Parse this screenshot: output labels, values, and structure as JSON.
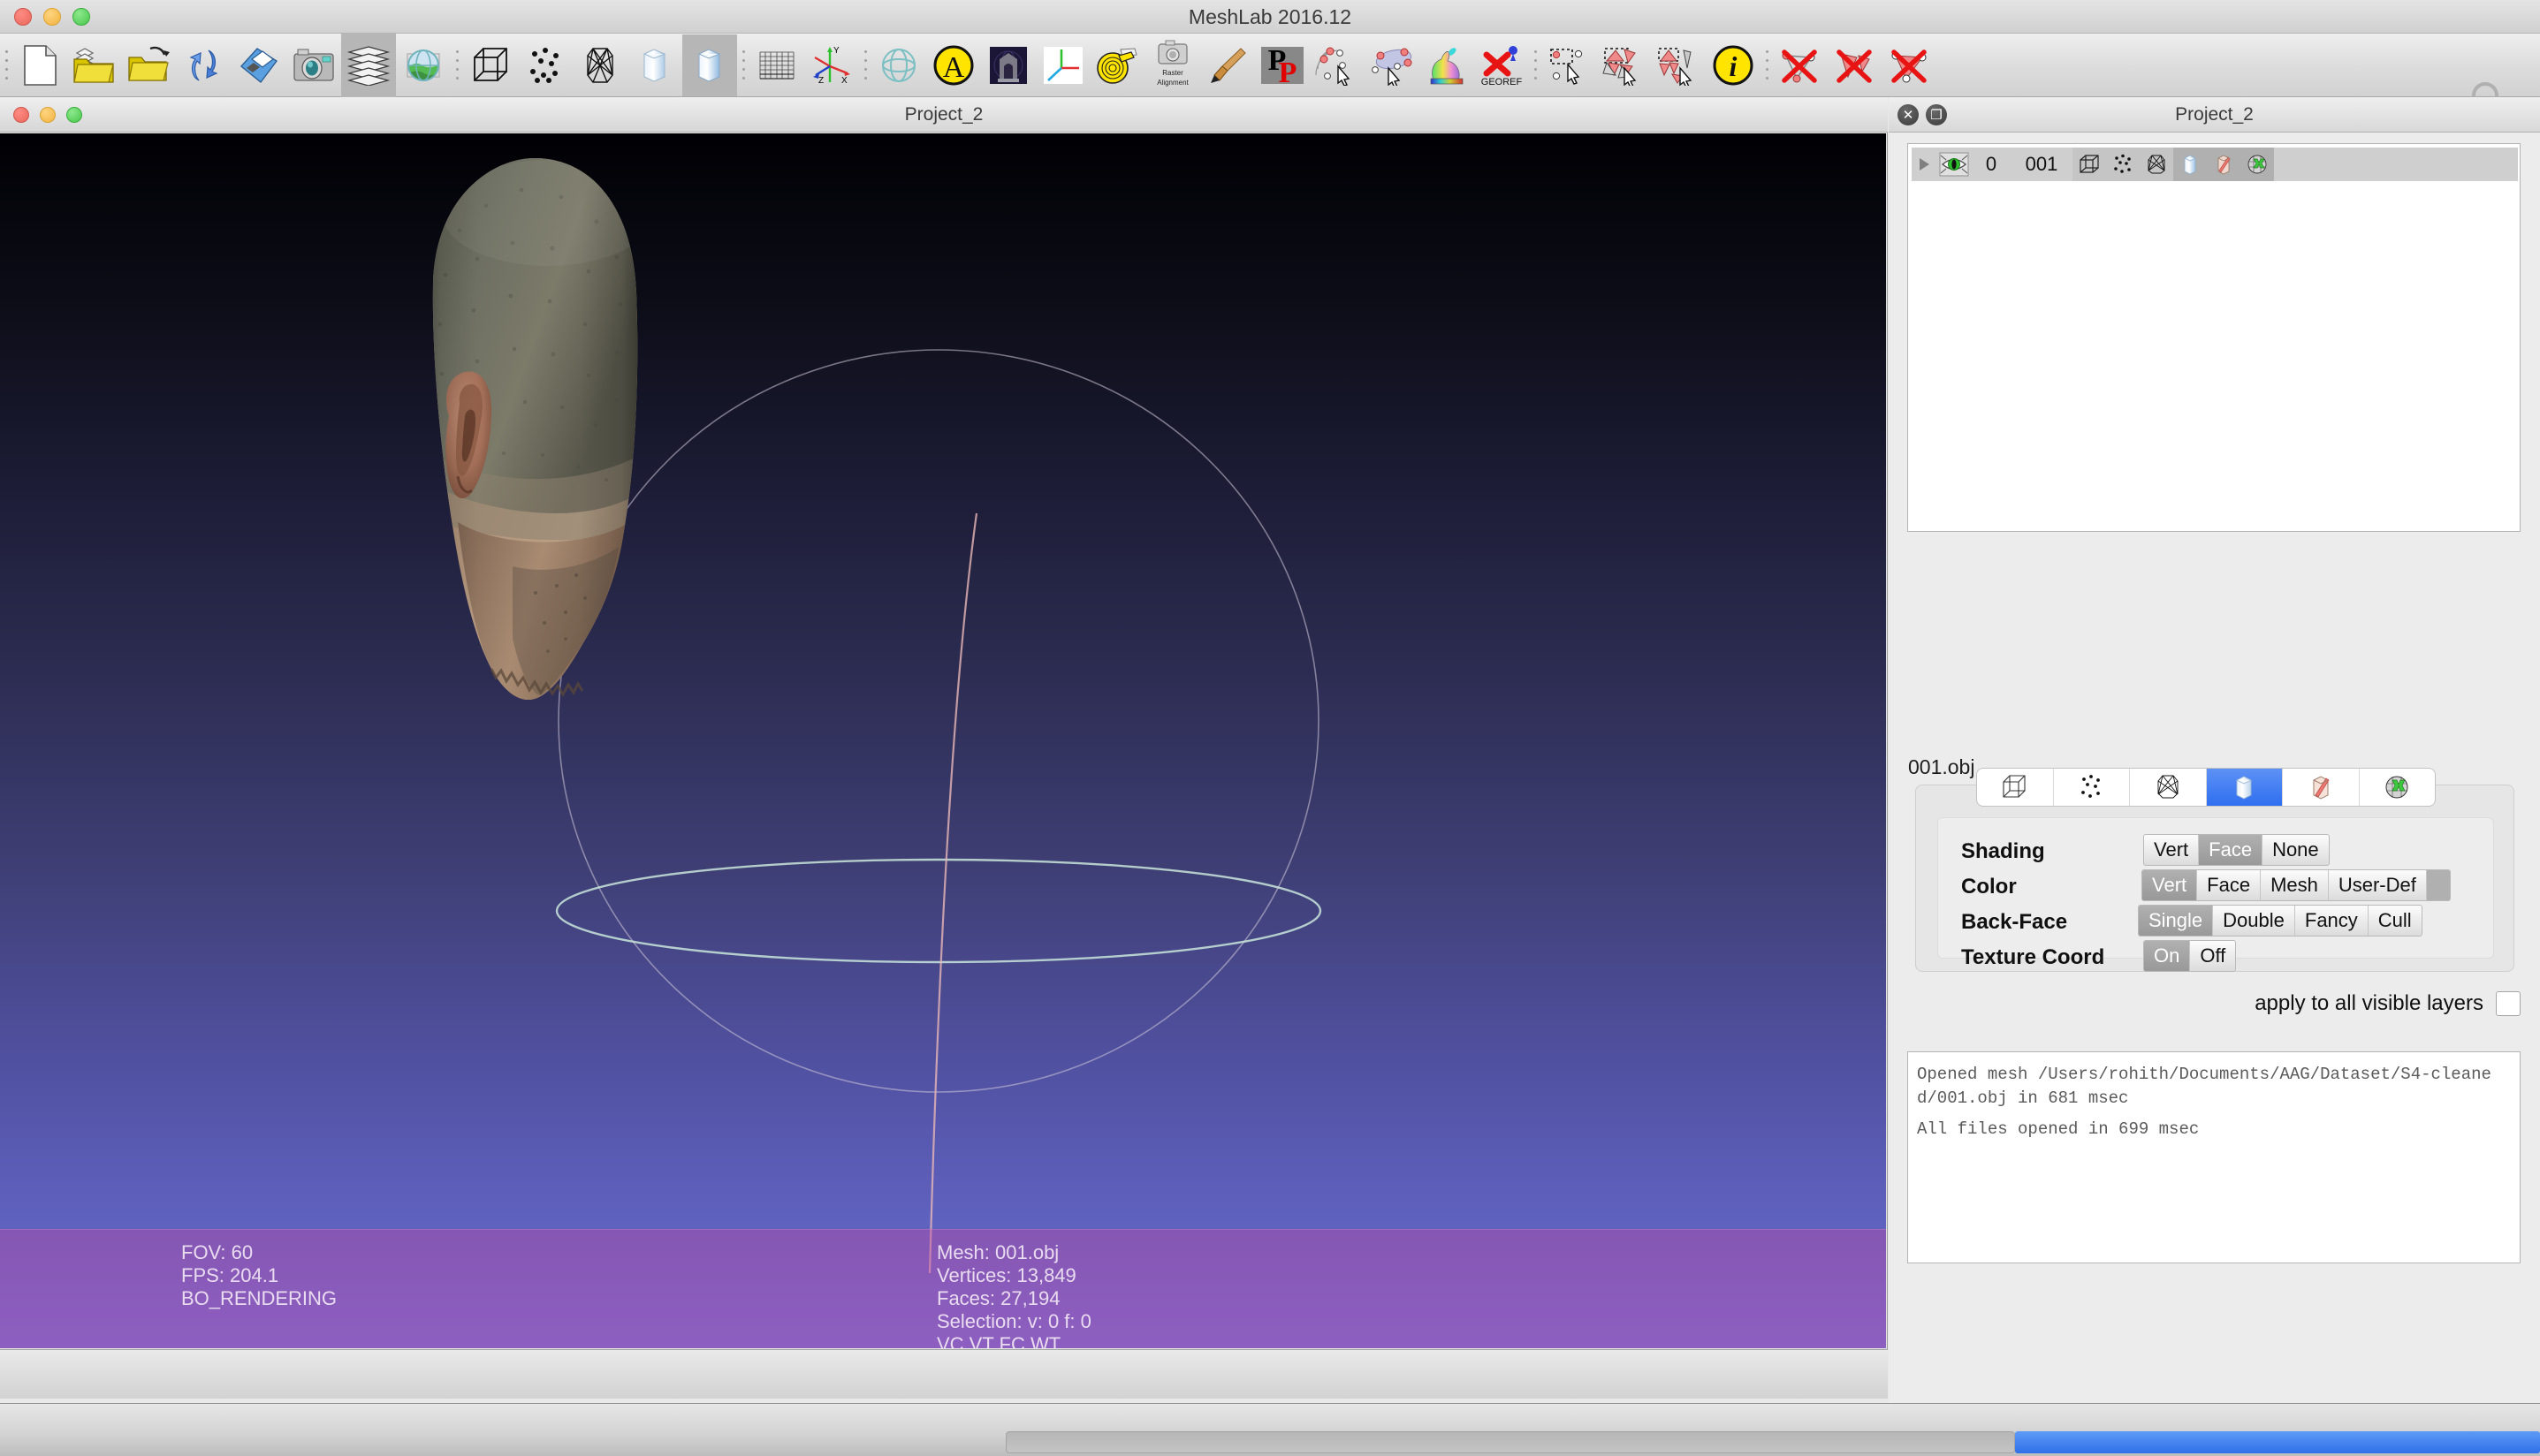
{
  "app": {
    "title": "MeshLab 2016.12",
    "window_controls": [
      "close",
      "minimize",
      "maximize"
    ]
  },
  "toolbar": {
    "groups": [
      {
        "name": "file",
        "buttons": [
          {
            "icon": "new-document-icon",
            "label": "New Project"
          },
          {
            "icon": "open-project-icon",
            "label": "Open Project"
          },
          {
            "icon": "open-mesh-icon",
            "label": "Import Mesh"
          },
          {
            "icon": "reload-icon",
            "label": "Reload"
          },
          {
            "icon": "save-mesh-icon",
            "label": "Save Mesh"
          },
          {
            "icon": "snapshot-camera-icon",
            "label": "Take Snapshot"
          }
        ]
      },
      {
        "name": "layers",
        "buttons": [
          {
            "icon": "layers-stack-icon",
            "label": "Show Layer Dialog",
            "selected": true
          }
        ]
      },
      {
        "name": "view-globe",
        "buttons": [
          {
            "icon": "globe-raster-icon",
            "label": "Show Raster"
          }
        ]
      },
      {
        "name": "render-modes",
        "buttons": [
          {
            "icon": "bounding-box-icon",
            "label": "Bounding Box"
          },
          {
            "icon": "points-icon",
            "label": "Points"
          },
          {
            "icon": "wireframe-icon",
            "label": "Wireframe"
          },
          {
            "icon": "flat-lines-icon",
            "label": "Flat Lines"
          },
          {
            "icon": "smooth-shading-icon",
            "label": "Smooth",
            "selected": true
          }
        ]
      },
      {
        "name": "helpers",
        "buttons": [
          {
            "icon": "grid-plane-icon",
            "label": "Show Grid"
          },
          {
            "icon": "axis-xyz-icon",
            "label": "Show Axis"
          }
        ]
      },
      {
        "name": "decorations",
        "buttons": [
          {
            "icon": "trackball-sphere-icon",
            "label": "Show Trackball"
          },
          {
            "icon": "yellow-a-icon",
            "label": "Show Text"
          },
          {
            "icon": "arch-render-icon",
            "label": "Shadow Render"
          },
          {
            "icon": "axis-cross-icon",
            "label": "Show Quoted Box"
          },
          {
            "icon": "measure-tape-icon",
            "label": "Measuring Tool"
          },
          {
            "icon": "raster-alignment-icon",
            "label": "Raster Alignment"
          },
          {
            "icon": "paintbrush-icon",
            "label": "Z-Painting"
          },
          {
            "icon": "pp-picker-icon",
            "label": "PickPoints"
          }
        ]
      },
      {
        "name": "alignment",
        "buttons": [
          {
            "icon": "point-select-icon",
            "label": "Select Points"
          },
          {
            "icon": "align-mesh-icon",
            "label": "Align Mesh"
          },
          {
            "icon": "colorize-bunny-icon",
            "label": "Quality Mapper"
          },
          {
            "icon": "georef-icon",
            "label": "GEOREF"
          }
        ]
      },
      {
        "name": "selection",
        "buttons": [
          {
            "icon": "select-vertices-rect-icon",
            "label": "Select Vertices"
          },
          {
            "icon": "select-faces-rect-icon",
            "label": "Select Faces"
          },
          {
            "icon": "select-connected-icon",
            "label": "Select Connected Component"
          },
          {
            "icon": "info-icon",
            "label": "Get Info"
          }
        ]
      },
      {
        "name": "delete",
        "buttons": [
          {
            "icon": "delete-vertices-icon",
            "label": "Delete Selected Vertices"
          },
          {
            "icon": "delete-faces-icon",
            "label": "Delete Selected Faces"
          },
          {
            "icon": "delete-faces-vertices-icon",
            "label": "Delete Selected Faces and Vertices"
          }
        ]
      }
    ],
    "search_icon": "search-icon"
  },
  "document_window": {
    "title": "Project_2",
    "viewport": {
      "background_top_color": "#000004",
      "background_bottom_color": "#6d70d6",
      "trackball_visible": true,
      "mesh_description": "3D scanned human head viewed from behind"
    },
    "overlay": {
      "fov": "FOV: 60",
      "fps": "FPS:   204.1",
      "rendering_mode": "BO_RENDERING",
      "mesh": "Mesh: 001.obj",
      "vertices": "Vertices: 13,849",
      "faces": "Faces: 27,194",
      "selection": "Selection: v: 0 f: 0",
      "attributes": "VC VT FC WT",
      "text_color": "#e9dcf0",
      "band_color": "#8a4487"
    }
  },
  "dock": {
    "title": "Project_2",
    "buttons": [
      {
        "icon": "close-icon",
        "glyph": "✕"
      },
      {
        "icon": "undock-icon",
        "glyph": "❐"
      }
    ],
    "layer_tree": {
      "rows": [
        {
          "expander": "triangle-right-icon",
          "visibility_icon": "eye-visible-icon",
          "index": "0",
          "name": "001",
          "render_icons": [
            {
              "icon": "bounding-box-icon",
              "active": false
            },
            {
              "icon": "points-icon",
              "active": false
            },
            {
              "icon": "wireframe-icon",
              "active": false
            },
            {
              "icon": "smooth-shading-icon",
              "active": true
            },
            {
              "icon": "flat-lines-icon",
              "active": true
            },
            {
              "icon": "texture-icon",
              "active": true
            }
          ]
        }
      ]
    },
    "selected_object": "001.obj",
    "render_mode_tabs": [
      {
        "icon": "bounding-box-icon",
        "active": false
      },
      {
        "icon": "points-icon",
        "active": false
      },
      {
        "icon": "wireframe-icon",
        "active": false
      },
      {
        "icon": "smooth-shading-icon",
        "active": true
      },
      {
        "icon": "flat-lines-icon",
        "active": false
      },
      {
        "icon": "texture-icon",
        "active": false
      }
    ],
    "properties": [
      {
        "label": "Shading",
        "name": "shading",
        "options": [
          "Vert",
          "Face",
          "None"
        ],
        "selected": "Face",
        "trailing_blank": false
      },
      {
        "label": "Color",
        "name": "color",
        "options": [
          "Vert",
          "Face",
          "Mesh",
          "User-Def"
        ],
        "selected": "Vert",
        "trailing_blank": true
      },
      {
        "label": "Back-Face",
        "name": "back-face",
        "options": [
          "Single",
          "Double",
          "Fancy",
          "Cull"
        ],
        "selected": "Single",
        "trailing_blank": false
      },
      {
        "label": "Texture Coord",
        "name": "texture-coord",
        "options": [
          "On",
          "Off"
        ],
        "selected": "On",
        "trailing_blank": false
      }
    ],
    "apply_all": {
      "label": "apply to all visible layers",
      "checked": false
    },
    "log": [
      "Opened mesh /Users/rohith/Documents/AAG/Dataset/S4-cleaned/001.obj in 681 msec",
      "All files opened in 699 msec"
    ]
  },
  "statusbar": {
    "progress_visible": true,
    "progress_color": "#2f6fe8"
  }
}
